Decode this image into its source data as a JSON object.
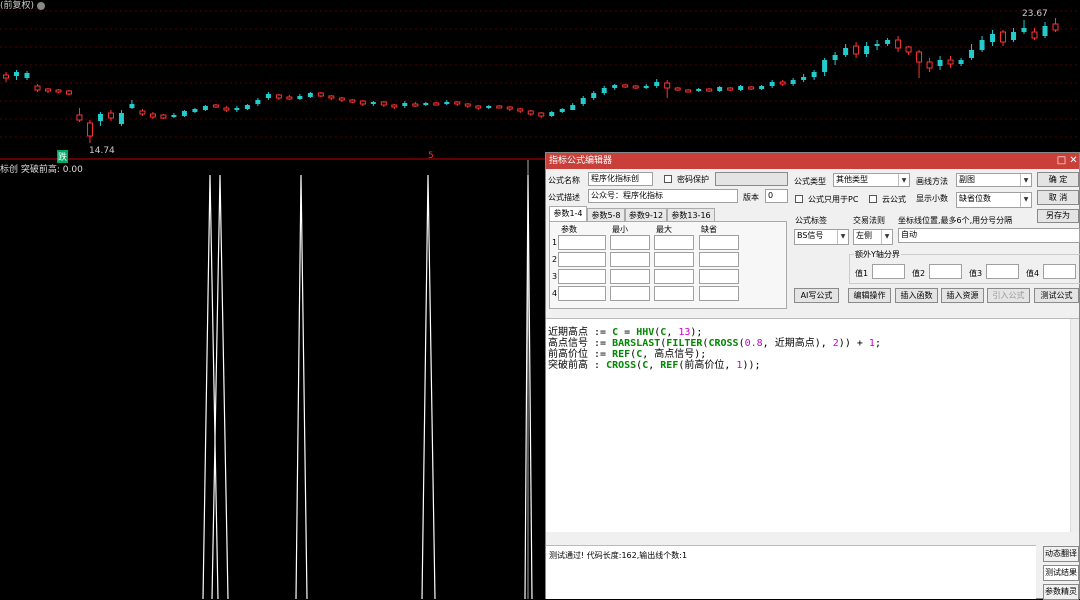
{
  "chart": {
    "title_fragment": "(前复权)",
    "high_label": "23.67",
    "low_label": "14.74",
    "low_marker": "跌",
    "divider_marker": "5",
    "candles": [
      {
        "o": 75,
        "c": 78,
        "h": 72,
        "l": 82,
        "u": 0
      },
      {
        "o": 76,
        "c": 72,
        "h": 70,
        "l": 80,
        "u": 1
      },
      {
        "o": 73,
        "c": 78,
        "h": 71,
        "l": 80,
        "u": 1
      },
      {
        "o": 86,
        "c": 90,
        "h": 84,
        "l": 92,
        "u": 0
      },
      {
        "o": 89,
        "c": 91,
        "h": 88,
        "l": 93,
        "u": 0
      },
      {
        "o": 90,
        "c": 92,
        "h": 89,
        "l": 93,
        "u": 0
      },
      {
        "o": 91,
        "c": 94,
        "h": 90,
        "l": 95,
        "u": 0
      },
      {
        "o": 115,
        "c": 120,
        "h": 108,
        "l": 122,
        "u": 0
      },
      {
        "o": 123,
        "c": 136,
        "h": 120,
        "l": 143,
        "u": 0
      },
      {
        "o": 121,
        "c": 114,
        "h": 112,
        "l": 126,
        "u": 1
      },
      {
        "o": 113,
        "c": 118,
        "h": 110,
        "l": 121,
        "u": 0
      },
      {
        "o": 124,
        "c": 113,
        "h": 110,
        "l": 126,
        "u": 1
      },
      {
        "o": 104,
        "c": 108,
        "h": 100,
        "l": 109,
        "u": 1
      },
      {
        "o": 111,
        "c": 114,
        "h": 109,
        "l": 116,
        "u": 0
      },
      {
        "o": 114,
        "c": 117,
        "h": 112,
        "l": 119,
        "u": 0
      },
      {
        "o": 115,
        "c": 118,
        "h": 114,
        "l": 119,
        "u": 0
      },
      {
        "o": 117,
        "c": 115,
        "h": 113,
        "l": 118,
        "u": 1
      },
      {
        "o": 116,
        "c": 111,
        "h": 110,
        "l": 117,
        "u": 1
      },
      {
        "o": 112,
        "c": 109,
        "h": 108,
        "l": 113,
        "u": 1
      },
      {
        "o": 110,
        "c": 106,
        "h": 105,
        "l": 111,
        "u": 1
      },
      {
        "o": 105,
        "c": 106,
        "h": 104,
        "l": 108,
        "u": 0
      },
      {
        "o": 108,
        "c": 110,
        "h": 106,
        "l": 112,
        "u": 0
      },
      {
        "o": 110,
        "c": 108,
        "h": 106,
        "l": 112,
        "u": 1
      },
      {
        "o": 109,
        "c": 105,
        "h": 104,
        "l": 110,
        "u": 1
      },
      {
        "o": 104,
        "c": 100,
        "h": 98,
        "l": 106,
        "u": 1
      },
      {
        "o": 98,
        "c": 94,
        "h": 92,
        "l": 100,
        "u": 1
      },
      {
        "o": 95,
        "c": 98,
        "h": 94,
        "l": 100,
        "u": 0
      },
      {
        "o": 97,
        "c": 99,
        "h": 95,
        "l": 100,
        "u": 0
      },
      {
        "o": 99,
        "c": 96,
        "h": 94,
        "l": 100,
        "u": 1
      },
      {
        "o": 97,
        "c": 93,
        "h": 92,
        "l": 98,
        "u": 1
      },
      {
        "o": 93,
        "c": 96,
        "h": 92,
        "l": 97,
        "u": 0
      },
      {
        "o": 96,
        "c": 98,
        "h": 95,
        "l": 100,
        "u": 0
      },
      {
        "o": 98,
        "c": 100,
        "h": 97,
        "l": 102,
        "u": 0
      },
      {
        "o": 100,
        "c": 102,
        "h": 99,
        "l": 103,
        "u": 0
      },
      {
        "o": 101,
        "c": 104,
        "h": 100,
        "l": 106,
        "u": 0
      },
      {
        "o": 104,
        "c": 102,
        "h": 101,
        "l": 106,
        "u": 1
      },
      {
        "o": 102,
        "c": 105,
        "h": 101,
        "l": 107,
        "u": 0
      },
      {
        "o": 105,
        "c": 107,
        "h": 104,
        "l": 109,
        "u": 0
      },
      {
        "o": 106,
        "c": 103,
        "h": 101,
        "l": 108,
        "u": 1
      },
      {
        "o": 104,
        "c": 105,
        "h": 102,
        "l": 107,
        "u": 0
      },
      {
        "o": 105,
        "c": 103,
        "h": 102,
        "l": 106,
        "u": 1
      },
      {
        "o": 103,
        "c": 104,
        "h": 102,
        "l": 105,
        "u": 0
      },
      {
        "o": 104,
        "c": 102,
        "h": 100,
        "l": 105,
        "u": 1
      },
      {
        "o": 102,
        "c": 104,
        "h": 101,
        "l": 106,
        "u": 0
      },
      {
        "o": 104,
        "c": 106,
        "h": 103,
        "l": 108,
        "u": 0
      },
      {
        "o": 106,
        "c": 108,
        "h": 105,
        "l": 110,
        "u": 0
      },
      {
        "o": 108,
        "c": 106,
        "h": 105,
        "l": 109,
        "u": 1
      },
      {
        "o": 106,
        "c": 107,
        "h": 105,
        "l": 108,
        "u": 0
      },
      {
        "o": 107,
        "c": 109,
        "h": 106,
        "l": 111,
        "u": 0
      },
      {
        "o": 109,
        "c": 111,
        "h": 108,
        "l": 113,
        "u": 0
      },
      {
        "o": 111,
        "c": 114,
        "h": 110,
        "l": 116,
        "u": 0
      },
      {
        "o": 113,
        "c": 116,
        "h": 112,
        "l": 118,
        "u": 0
      },
      {
        "o": 116,
        "c": 112,
        "h": 111,
        "l": 117,
        "u": 1
      },
      {
        "o": 112,
        "c": 109,
        "h": 108,
        "l": 113,
        "u": 1
      },
      {
        "o": 110,
        "c": 105,
        "h": 103,
        "l": 110,
        "u": 1
      },
      {
        "o": 104,
        "c": 98,
        "h": 96,
        "l": 106,
        "u": 1
      },
      {
        "o": 98,
        "c": 93,
        "h": 91,
        "l": 100,
        "u": 1
      },
      {
        "o": 93,
        "c": 88,
        "h": 86,
        "l": 95,
        "u": 1
      },
      {
        "o": 88,
        "c": 85,
        "h": 84,
        "l": 90,
        "u": 1
      },
      {
        "o": 85,
        "c": 86,
        "h": 84,
        "l": 88,
        "u": 0
      },
      {
        "o": 86,
        "c": 88,
        "h": 85,
        "l": 89,
        "u": 0
      },
      {
        "o": 88,
        "c": 86,
        "h": 84,
        "l": 89,
        "u": 1
      },
      {
        "o": 86,
        "c": 82,
        "h": 79,
        "l": 88,
        "u": 1
      },
      {
        "o": 83,
        "c": 88,
        "h": 80,
        "l": 98,
        "u": 0
      },
      {
        "o": 88,
        "c": 90,
        "h": 87,
        "l": 91,
        "u": 0
      },
      {
        "o": 90,
        "c": 91,
        "h": 89,
        "l": 92,
        "u": 0
      },
      {
        "o": 91,
        "c": 89,
        "h": 88,
        "l": 92,
        "u": 1
      },
      {
        "o": 89,
        "c": 91,
        "h": 88,
        "l": 92,
        "u": 0
      },
      {
        "o": 91,
        "c": 87,
        "h": 86,
        "l": 92,
        "u": 1
      },
      {
        "o": 88,
        "c": 90,
        "h": 87,
        "l": 91,
        "u": 0
      },
      {
        "o": 90,
        "c": 86,
        "h": 85,
        "l": 91,
        "u": 1
      },
      {
        "o": 87,
        "c": 89,
        "h": 86,
        "l": 90,
        "u": 0
      },
      {
        "o": 89,
        "c": 86,
        "h": 85,
        "l": 90,
        "u": 1
      },
      {
        "o": 86,
        "c": 82,
        "h": 80,
        "l": 88,
        "u": 1
      },
      {
        "o": 82,
        "c": 84,
        "h": 80,
        "l": 86,
        "u": 0
      },
      {
        "o": 84,
        "c": 80,
        "h": 78,
        "l": 86,
        "u": 1
      },
      {
        "o": 80,
        "c": 77,
        "h": 74,
        "l": 82,
        "u": 1
      },
      {
        "o": 77,
        "c": 72,
        "h": 70,
        "l": 80,
        "u": 1
      },
      {
        "o": 72,
        "c": 60,
        "h": 58,
        "l": 76,
        "u": 1
      },
      {
        "o": 60,
        "c": 55,
        "h": 52,
        "l": 65,
        "u": 1
      },
      {
        "o": 55,
        "c": 48,
        "h": 44,
        "l": 57,
        "u": 1
      },
      {
        "o": 46,
        "c": 54,
        "h": 42,
        "l": 58,
        "u": 0
      },
      {
        "o": 54,
        "c": 46,
        "h": 42,
        "l": 57,
        "u": 1
      },
      {
        "o": 46,
        "c": 44,
        "h": 40,
        "l": 50,
        "u": 1
      },
      {
        "o": 44,
        "c": 40,
        "h": 38,
        "l": 46,
        "u": 1
      },
      {
        "o": 40,
        "c": 48,
        "h": 36,
        "l": 52,
        "u": 0
      },
      {
        "o": 47,
        "c": 52,
        "h": 46,
        "l": 55,
        "u": 0
      },
      {
        "o": 52,
        "c": 62,
        "h": 50,
        "l": 78,
        "u": 0
      },
      {
        "o": 62,
        "c": 68,
        "h": 58,
        "l": 72,
        "u": 0
      },
      {
        "o": 66,
        "c": 60,
        "h": 56,
        "l": 70,
        "u": 1
      },
      {
        "o": 60,
        "c": 64,
        "h": 56,
        "l": 68,
        "u": 0
      },
      {
        "o": 64,
        "c": 60,
        "h": 58,
        "l": 66,
        "u": 1
      },
      {
        "o": 58,
        "c": 50,
        "h": 44,
        "l": 60,
        "u": 1
      },
      {
        "o": 50,
        "c": 40,
        "h": 36,
        "l": 52,
        "u": 1
      },
      {
        "o": 42,
        "c": 34,
        "h": 30,
        "l": 46,
        "u": 1
      },
      {
        "o": 32,
        "c": 42,
        "h": 30,
        "l": 46,
        "u": 0
      },
      {
        "o": 40,
        "c": 32,
        "h": 28,
        "l": 42,
        "u": 1
      },
      {
        "o": 32,
        "c": 28,
        "h": 20,
        "l": 34,
        "u": 1
      },
      {
        "o": 32,
        "c": 38,
        "h": 28,
        "l": 40,
        "u": 0
      },
      {
        "o": 36,
        "c": 26,
        "h": 22,
        "l": 38,
        "u": 1
      },
      {
        "o": 24,
        "c": 30,
        "h": 18,
        "l": 32,
        "u": 0
      }
    ]
  },
  "indicator": {
    "label": "标创 突破前高: 0.00"
  },
  "dialog": {
    "title": "指标公式编辑器",
    "name_label": "公式名称",
    "name_value": "程序化指标创",
    "password_label": "密码保护",
    "desc_label": "公式描述",
    "desc_value": "公众号：程序化指标",
    "version_label": "版本",
    "version_value": "0",
    "type_label": "公式类型",
    "type_value": "其他类型",
    "draw_label": "画线方法",
    "draw_value": "副图",
    "pc_only_label": "公式只用于PC",
    "cloud_label": "云公式",
    "decimals_label": "显示小数",
    "decimals_value": "缺省位数",
    "ok_label": "确 定",
    "cancel_label": "取 消",
    "save_as_label": "另存为",
    "tabs": [
      "参数1-4",
      "参数5-8",
      "参数9-12",
      "参数13-16"
    ],
    "param_headers": [
      "参数",
      "最小",
      "最大",
      "缺省"
    ],
    "param_rows": [
      "1",
      "2",
      "3",
      "4"
    ],
    "tag_label": "公式标签",
    "trade_label": "交易法则",
    "coord_label": "坐标线位置,最多6个,用分号分隔",
    "tag_value": "BS信号",
    "trade_value": "左侧",
    "coord_value": "自动",
    "extra_y_label": "额外Y轴分界",
    "val_labels": [
      "值1",
      "值2",
      "值3",
      "值4"
    ],
    "ai_btn": "AI写公式",
    "edit_btn": "编辑操作",
    "insert_fn_btn": "插入函数",
    "insert_res_btn": "插入资源",
    "import_btn": "引入公式",
    "test_btn": "测试公式",
    "code_lines": [
      [
        {
          "t": "近期高点 := ",
          "c": "op"
        },
        {
          "t": "C",
          "c": "kw"
        },
        {
          "t": " = ",
          "c": "op"
        },
        {
          "t": "HHV",
          "c": "kw"
        },
        {
          "t": "(",
          "c": "op"
        },
        {
          "t": "C",
          "c": "kw"
        },
        {
          "t": ", ",
          "c": "op"
        },
        {
          "t": "13",
          "c": "num"
        },
        {
          "t": ");",
          "c": "op"
        }
      ],
      [
        {
          "t": "高点信号 := ",
          "c": "op"
        },
        {
          "t": "BARSLAST",
          "c": "kw"
        },
        {
          "t": "(",
          "c": "op"
        },
        {
          "t": "FILTER",
          "c": "kw"
        },
        {
          "t": "(",
          "c": "op"
        },
        {
          "t": "CROSS",
          "c": "kw"
        },
        {
          "t": "(",
          "c": "op"
        },
        {
          "t": "0.8",
          "c": "num"
        },
        {
          "t": ", 近期高点), ",
          "c": "op"
        },
        {
          "t": "2",
          "c": "num"
        },
        {
          "t": ")) + ",
          "c": "op"
        },
        {
          "t": "1",
          "c": "num"
        },
        {
          "t": ";",
          "c": "op"
        }
      ],
      [
        {
          "t": "前高价位 := ",
          "c": "op"
        },
        {
          "t": "REF",
          "c": "kw"
        },
        {
          "t": "(",
          "c": "op"
        },
        {
          "t": "C",
          "c": "kw"
        },
        {
          "t": ", 高点信号);",
          "c": "op"
        }
      ],
      [
        {
          "t": "突破前高 : ",
          "c": "op"
        },
        {
          "t": "CROSS",
          "c": "kw"
        },
        {
          "t": "(",
          "c": "op"
        },
        {
          "t": "C",
          "c": "kw"
        },
        {
          "t": ", ",
          "c": "op"
        },
        {
          "t": "REF",
          "c": "kw"
        },
        {
          "t": "(前高价位, ",
          "c": "op"
        },
        {
          "t": "1",
          "c": "num"
        },
        {
          "t": "));",
          "c": "op"
        }
      ]
    ],
    "status_text": "测试通过! 代码长度:162,输出线个数:1",
    "side_btns": [
      "动态翻译",
      "测试结果",
      "参数精灵"
    ]
  }
}
